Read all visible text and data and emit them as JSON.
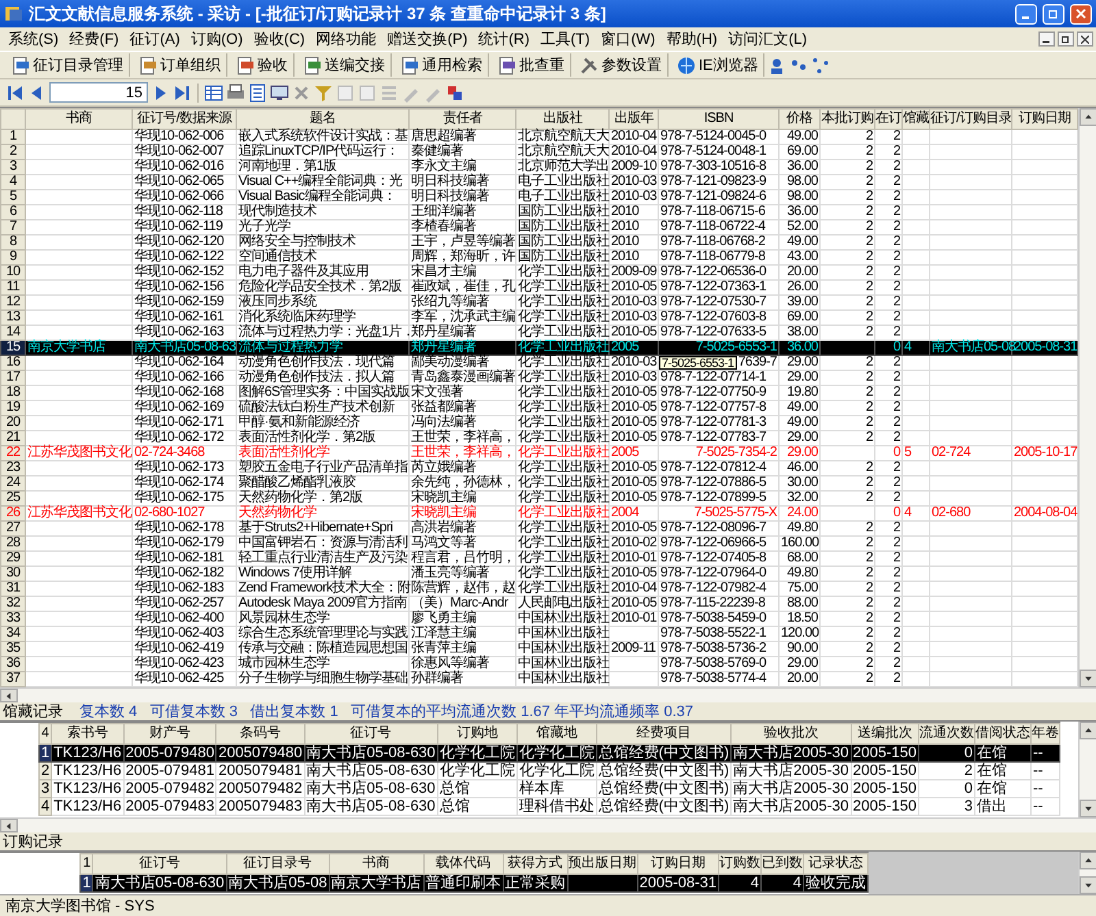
{
  "window": {
    "title": "汇文文献信息服务系统 - 采访 - [-批征订/订购记录计 37 条 查重命中记录计 3 条]"
  },
  "menu": [
    "系统(S)",
    "经费(F)",
    "征订(A)",
    "订购(O)",
    "验收(C)",
    "网络功能",
    "赠送交换(P)",
    "统计(R)",
    "工具(T)",
    "窗口(W)",
    "帮助(H)",
    "访问汇文(L)"
  ],
  "toolbar": [
    "征订目录管理",
    "订单组织",
    "验收",
    "送编交接",
    "通用检索",
    "批查重",
    "参数设置",
    "IE浏览器"
  ],
  "navigator": {
    "value": "15"
  },
  "records": {
    "columns": [
      "书商",
      "征订号/数据来源",
      "题名",
      "责任者",
      "出版社",
      "出版年",
      "ISBN",
      "价格",
      "本批订购",
      "在订",
      "馆藏",
      "征订/订购目录",
      "订购日期"
    ],
    "rows": [
      {
        "number": "1",
        "order_no": "华现10-062-006",
        "title": "嵌入式系统软件设计实战：基",
        "author": "唐思超编著",
        "publisher": "北京航空航天大",
        "year": "2010-04",
        "isbn": "978-7-5124-0045-0",
        "price": "49.00",
        "batch_qty": "2",
        "on_order": "2",
        "selected": false,
        "kind": "normal"
      },
      {
        "number": "2",
        "order_no": "华现10-062-007",
        "title": "追踪LinuxTCP/IP代码运行：",
        "author": "秦健编著",
        "publisher": "北京航空航天大",
        "year": "2010-04",
        "isbn": "978-7-5124-0048-1",
        "price": "69.00",
        "batch_qty": "2",
        "on_order": "2",
        "selected": false,
        "kind": "normal"
      },
      {
        "number": "3",
        "order_no": "华现10-062-016",
        "title": "河南地理．第1版",
        "author": "李永文主编",
        "publisher": "北京师范大学出",
        "year": "2009-10",
        "isbn": "978-7-303-10516-8",
        "price": "36.00",
        "batch_qty": "2",
        "on_order": "2",
        "selected": false,
        "kind": "normal"
      },
      {
        "number": "4",
        "order_no": "华现10-062-065",
        "title": "Visual C++编程全能词典：光",
        "author": "明日科技编著",
        "publisher": "电子工业出版社",
        "year": "2010-03",
        "isbn": "978-7-121-09823-9",
        "price": "98.00",
        "batch_qty": "2",
        "on_order": "2",
        "selected": false,
        "kind": "normal"
      },
      {
        "number": "5",
        "order_no": "华现10-062-066",
        "title": "Visual Basic编程全能词典：",
        "author": "明日科技编著",
        "publisher": "电子工业出版社",
        "year": "2010-03",
        "isbn": "978-7-121-09824-6",
        "price": "98.00",
        "batch_qty": "2",
        "on_order": "2",
        "selected": false,
        "kind": "normal"
      },
      {
        "number": "6",
        "order_no": "华现10-062-118",
        "title": "现代制造技术",
        "author": "王细洋编著",
        "publisher": "国防工业出版社",
        "year": "2010",
        "isbn": "978-7-118-06715-6",
        "price": "36.00",
        "batch_qty": "2",
        "on_order": "2",
        "selected": false,
        "kind": "normal"
      },
      {
        "number": "7",
        "order_no": "华现10-062-119",
        "title": "光子光学",
        "author": "李楂春编著",
        "publisher": "国防工业出版社",
        "year": "2010",
        "isbn": "978-7-118-06722-4",
        "price": "52.00",
        "batch_qty": "2",
        "on_order": "2",
        "selected": false,
        "kind": "normal"
      },
      {
        "number": "8",
        "order_no": "华现10-062-120",
        "title": "网络安全与控制技术",
        "author": "王宇，卢昱等编著",
        "publisher": "国防工业出版社",
        "year": "2010",
        "isbn": "978-7-118-06768-2",
        "price": "49.00",
        "batch_qty": "2",
        "on_order": "2",
        "selected": false,
        "kind": "normal"
      },
      {
        "number": "9",
        "order_no": "华现10-062-122",
        "title": "空间通信技术",
        "author": "周辉，郑海昕，许",
        "publisher": "国防工业出版社",
        "year": "2010",
        "isbn": "978-7-118-06779-8",
        "price": "43.00",
        "batch_qty": "2",
        "on_order": "2",
        "selected": false,
        "kind": "normal"
      },
      {
        "number": "10",
        "order_no": "华现10-062-152",
        "title": "电力电子器件及其应用",
        "author": "宋昌才主编",
        "publisher": "化学工业出版社",
        "year": "2009-09",
        "isbn": "978-7-122-06536-0",
        "price": "20.00",
        "batch_qty": "2",
        "on_order": "2",
        "selected": false,
        "kind": "normal"
      },
      {
        "number": "11",
        "order_no": "华现10-062-156",
        "title": "危险化学品安全技术．第2版",
        "author": "崔政斌，崔佳，孔",
        "publisher": "化学工业出版社",
        "year": "2010-05",
        "isbn": "978-7-122-07363-1",
        "price": "26.00",
        "batch_qty": "2",
        "on_order": "2",
        "selected": false,
        "kind": "normal"
      },
      {
        "number": "12",
        "order_no": "华现10-062-159",
        "title": "液压同步系统",
        "author": "张绍九等编著",
        "publisher": "化学工业出版社",
        "year": "2010-03",
        "isbn": "978-7-122-07530-7",
        "price": "39.00",
        "batch_qty": "2",
        "on_order": "2",
        "selected": false,
        "kind": "normal"
      },
      {
        "number": "13",
        "order_no": "华现10-062-161",
        "title": "消化系统临床药理学",
        "author": "李军，沈承武主编",
        "publisher": "化学工业出版社",
        "year": "2010-03",
        "isbn": "978-7-122-07603-8",
        "price": "69.00",
        "batch_qty": "2",
        "on_order": "2",
        "selected": false,
        "kind": "normal"
      },
      {
        "number": "14",
        "order_no": "华现10-062-163",
        "title": "流体与过程热力学：光盘1片．",
        "author": "郑丹星编著",
        "publisher": "化学工业出版社",
        "year": "2010-05",
        "isbn": "978-7-122-07633-5",
        "price": "38.00",
        "batch_qty": "2",
        "on_order": "2",
        "selected": false,
        "kind": "normal"
      },
      {
        "number": "15",
        "dealer": "南京大学书店",
        "order_no": "南大书店05-08-63",
        "title": "流体与过程热力学",
        "author": "郑丹星编著",
        "publisher": "化学工业出版社",
        "year": "2005",
        "isbn": "7-5025-6553-1",
        "price": "36.00",
        "on_order": "0",
        "holdings": "4",
        "catalog": "南大书店05-08",
        "order_date": "2005-08-31",
        "selected": true,
        "kind": "order"
      },
      {
        "number": "16",
        "order_no": "华现10-062-164",
        "title": "动漫角色创作技法．现代篇",
        "author": "鄙美动漫编著",
        "publisher": "化学工业出版社",
        "year": "2010-03",
        "isbn": "7639-7",
        "tooltip": "7-5025-6553-1",
        "price": "29.00",
        "batch_qty": "2",
        "on_order": "2",
        "selected": false,
        "kind": "normal"
      },
      {
        "number": "17",
        "order_no": "华现10-062-166",
        "title": "动漫角色创作技法．拟人篇",
        "author": "青岛鑫泰漫画编著",
        "publisher": "化学工业出版社",
        "year": "2010-03",
        "isbn": "978-7-122-07714-1",
        "price": "29.00",
        "batch_qty": "2",
        "on_order": "2",
        "selected": false,
        "kind": "normal"
      },
      {
        "number": "18",
        "order_no": "华现10-062-168",
        "title": "图解6S管理实务：中国实战版",
        "author": "宋文强著",
        "publisher": "化学工业出版社",
        "year": "2010-05",
        "isbn": "978-7-122-07750-9",
        "price": "19.80",
        "batch_qty": "2",
        "on_order": "2",
        "selected": false,
        "kind": "normal"
      },
      {
        "number": "19",
        "order_no": "华现10-062-169",
        "title": "硫酸法钛白粉生产技术创新",
        "author": "张益都编著",
        "publisher": "化学工业出版社",
        "year": "2010-05",
        "isbn": "978-7-122-07757-8",
        "price": "49.00",
        "batch_qty": "2",
        "on_order": "2",
        "selected": false,
        "kind": "normal"
      },
      {
        "number": "20",
        "order_no": "华现10-062-171",
        "title": "甲醇·氨和新能源经济",
        "author": "冯向法编著",
        "publisher": "化学工业出版社",
        "year": "2010-05",
        "isbn": "978-7-122-07781-3",
        "price": "49.00",
        "batch_qty": "2",
        "on_order": "2",
        "selected": false,
        "kind": "normal"
      },
      {
        "number": "21",
        "order_no": "华现10-062-172",
        "title": "表面活性剂化学．第2版",
        "author": "王世荣，李祥高，",
        "publisher": "化学工业出版社",
        "year": "2010-05",
        "isbn": "978-7-122-07783-7",
        "price": "29.00",
        "batch_qty": "2",
        "on_order": "2",
        "selected": false,
        "kind": "normal"
      },
      {
        "number": "22",
        "dealer": "江苏华茂图书文化",
        "order_no": "02-724-3468",
        "title": "表面活性剂化学",
        "author": "王世荣，李祥高，",
        "publisher": "化学工业出版社",
        "year": "2005",
        "isbn": "7-5025-7354-2",
        "price": "29.00",
        "on_order": "0",
        "holdings": "5",
        "catalog": "02-724",
        "order_date": "2005-10-17",
        "selected": false,
        "kind": "order"
      },
      {
        "number": "23",
        "order_no": "华现10-062-173",
        "title": "塑胶五金电子行业产品清单指",
        "author": "芮立娥编著",
        "publisher": "化学工业出版社",
        "year": "2010-05",
        "isbn": "978-7-122-07812-4",
        "price": "46.00",
        "batch_qty": "2",
        "on_order": "2",
        "selected": false,
        "kind": "normal"
      },
      {
        "number": "24",
        "order_no": "华现10-062-174",
        "title": "聚醋酸乙烯酯乳液胶",
        "author": "余先纯，孙德林，",
        "publisher": "化学工业出版社",
        "year": "2010-05",
        "isbn": "978-7-122-07886-5",
        "price": "30.00",
        "batch_qty": "2",
        "on_order": "2",
        "selected": false,
        "kind": "normal"
      },
      {
        "number": "25",
        "order_no": "华现10-062-175",
        "title": "天然药物化学．第2版",
        "author": "宋晓凯主编",
        "publisher": "化学工业出版社",
        "year": "2010-05",
        "isbn": "978-7-122-07899-5",
        "price": "32.00",
        "batch_qty": "2",
        "on_order": "2",
        "selected": false,
        "kind": "normal"
      },
      {
        "number": "26",
        "dealer": "江苏华茂图书文化",
        "order_no": "02-680-1027",
        "title": "天然药物化学",
        "author": "宋晓凯主编",
        "publisher": "化学工业出版社",
        "year": "2004",
        "isbn": "7-5025-5775-X",
        "price": "24.00",
        "on_order": "0",
        "holdings": "4",
        "catalog": "02-680",
        "order_date": "2004-08-04",
        "selected": false,
        "kind": "order"
      },
      {
        "number": "27",
        "order_no": "华现10-062-178",
        "title": "基于Struts2+Hibernate+Spri",
        "author": "高洪岩编著",
        "publisher": "化学工业出版社",
        "year": "2010-05",
        "isbn": "978-7-122-08096-7",
        "price": "49.80",
        "batch_qty": "2",
        "on_order": "2",
        "selected": false,
        "kind": "normal"
      },
      {
        "number": "28",
        "order_no": "华现10-062-179",
        "title": "中国富钾岩石：资源与清洁利",
        "author": "马鸿文等著",
        "publisher": "化学工业出版社",
        "year": "2010-02",
        "isbn": "978-7-122-06966-5",
        "price": "160.00",
        "batch_qty": "2",
        "on_order": "2",
        "selected": false,
        "kind": "normal"
      },
      {
        "number": "29",
        "order_no": "华现10-062-181",
        "title": "轻工重点行业清洁生产及污染",
        "author": "程言君，吕竹明，",
        "publisher": "化学工业出版社",
        "year": "2010-01",
        "isbn": "978-7-122-07405-8",
        "price": "68.00",
        "batch_qty": "2",
        "on_order": "2",
        "selected": false,
        "kind": "normal"
      },
      {
        "number": "30",
        "order_no": "华现10-062-182",
        "title": "Windows 7使用详解",
        "author": "潘玉亮等编著",
        "publisher": "化学工业出版社",
        "year": "2010-05",
        "isbn": "978-7-122-07964-0",
        "price": "49.80",
        "batch_qty": "2",
        "on_order": "2",
        "selected": false,
        "kind": "normal"
      },
      {
        "number": "31",
        "order_no": "华现10-062-183",
        "title": "Zend Framework技术大全：附",
        "author": "陈营辉，赵伟，赵",
        "publisher": "化学工业出版社",
        "year": "2010-04",
        "isbn": "978-7-122-07982-4",
        "price": "75.00",
        "batch_qty": "2",
        "on_order": "2",
        "selected": false,
        "kind": "normal"
      },
      {
        "number": "32",
        "order_no": "华现10-062-257",
        "title": "Autodesk Maya 2009官方指南",
        "author": "（美）Marc-Andr",
        "publisher": "人民邮电出版社",
        "year": "2010-05",
        "isbn": "978-7-115-22239-8",
        "price": "88.00",
        "batch_qty": "2",
        "on_order": "2",
        "selected": false,
        "kind": "normal"
      },
      {
        "number": "33",
        "order_no": "华现10-062-400",
        "title": "风景园林生态学",
        "author": "廖飞勇主编",
        "publisher": "中国林业出版社",
        "year": "2010-01",
        "isbn": "978-7-5038-5459-0",
        "price": "18.50",
        "batch_qty": "2",
        "on_order": "2",
        "selected": false,
        "kind": "normal"
      },
      {
        "number": "34",
        "order_no": "华现10-062-403",
        "title": "综合生态系统管理理论与实践",
        "author": "江泽慧主编",
        "publisher": "中国林业出版社",
        "isbn": "978-7-5038-5522-1",
        "price": "120.00",
        "batch_qty": "2",
        "on_order": "2",
        "selected": false,
        "kind": "normal"
      },
      {
        "number": "35",
        "order_no": "华现10-062-419",
        "title": "传承与交融：陈植造园思想国",
        "author": "张青萍主编",
        "publisher": "中国林业出版社",
        "year": "2009-11",
        "isbn": "978-7-5038-5736-2",
        "price": "90.00",
        "batch_qty": "2",
        "on_order": "2",
        "selected": false,
        "kind": "normal"
      },
      {
        "number": "36",
        "order_no": "华现10-062-423",
        "title": "城市园林生态学",
        "author": "徐惠风等编著",
        "publisher": "中国林业出版社",
        "isbn": "978-7-5038-5769-0",
        "price": "29.00",
        "batch_qty": "2",
        "on_order": "2",
        "selected": false,
        "kind": "normal"
      },
      {
        "number": "37",
        "order_no": "华现10-062-425",
        "title": "分子生物学与细胞生物学基础",
        "author": "孙群编著",
        "publisher": "中国林业出版社",
        "isbn": "978-7-5038-5774-4",
        "price": "20.00",
        "batch_qty": "2",
        "on_order": "2",
        "selected": false,
        "kind": "normal"
      }
    ]
  },
  "holdings": {
    "label": "馆藏记录",
    "summary": "复本数 4   可借复本数 3   借出复本数 1   可借复本的平均流通次数 1.67 年平均流通频率 0.37",
    "count": "4",
    "columns": [
      "索书号",
      "财产号",
      "条码号",
      "征订号",
      "订购地",
      "馆藏地",
      "经费项目",
      "验收批次",
      "送编批次",
      "流通次数",
      "借阅状态",
      "年卷"
    ],
    "rows": [
      {
        "number": "1",
        "cells": [
          "TK123/H6",
          "2005-079480",
          "2005079480",
          "南大书店05-08-630",
          "化学化工院",
          "化学化工院",
          "总馆经费(中文图书)",
          "南大书店2005-30",
          "2005-150",
          "0",
          "在馆",
          "--"
        ],
        "selected": true
      },
      {
        "number": "2",
        "cells": [
          "TK123/H6",
          "2005-079481",
          "2005079481",
          "南大书店05-08-630",
          "化学化工院",
          "化学化工院",
          "总馆经费(中文图书)",
          "南大书店2005-30",
          "2005-150",
          "2",
          "在馆",
          "--"
        ],
        "selected": false
      },
      {
        "number": "3",
        "cells": [
          "TK123/H6",
          "2005-079482",
          "2005079482",
          "南大书店05-08-630",
          "总馆",
          "样本库",
          "总馆经费(中文图书)",
          "南大书店2005-30",
          "2005-150",
          "0",
          "在馆",
          "--"
        ],
        "selected": false
      },
      {
        "number": "4",
        "cells": [
          "TK123/H6",
          "2005-079483",
          "2005079483",
          "南大书店05-08-630",
          "总馆",
          "理科借书处",
          "总馆经费(中文图书)",
          "南大书店2005-30",
          "2005-150",
          "3",
          "借出",
          "--"
        ],
        "selected": false
      }
    ]
  },
  "orders": {
    "label": "订购记录",
    "count": "1",
    "columns": [
      "征订号",
      "征订目录号",
      "书商",
      "载体代码",
      "获得方式",
      "预出版日期",
      "订购日期",
      "订购数",
      "已到数",
      "记录状态"
    ],
    "rows": [
      {
        "number": "1",
        "cells": [
          "南大书店05-08-630",
          "南大书店05-08",
          "南京大学书店",
          "普通印刷本",
          "正常采购",
          "",
          "2005-08-31",
          "4",
          "4",
          "验收完成"
        ],
        "selected": true
      }
    ]
  },
  "status_bar": "南京大学图书馆 - SYS"
}
